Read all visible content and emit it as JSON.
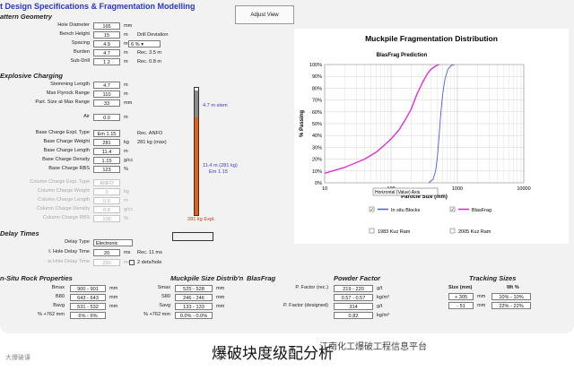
{
  "title": "t Design Specifications & Fragmentation Modelling",
  "adjust_button": "Adjust View",
  "pattern": {
    "heading": "attern Geometry",
    "rows": [
      {
        "label": "Hole Diameter",
        "value": "165",
        "unit": "mm",
        "extra": ""
      },
      {
        "label": "Bench Height",
        "value": "15",
        "unit": "m",
        "extra": "Drill Deviation"
      },
      {
        "label": "Spacing",
        "value": "4.9",
        "unit": "m",
        "extra": ""
      },
      {
        "label": "Burden",
        "value": "4.7",
        "unit": "m",
        "extra": "Rec. 3.5 m"
      },
      {
        "label": "Sub-Drill",
        "value": "1.2",
        "unit": "m",
        "extra": "Rec. 0.8 m"
      }
    ],
    "deviation": "6 %"
  },
  "explosive": {
    "heading": "Explosive Charging",
    "rows": [
      {
        "label": "Stemming Length",
        "value": "4.7",
        "unit": "m",
        "extra": ""
      },
      {
        "label": "Max Flyrock Range",
        "value": "110",
        "unit": "m",
        "extra": ""
      },
      {
        "label": "Part. Size at Max Range",
        "value": "33",
        "unit": "mm",
        "extra": ""
      },
      {
        "label": "Air",
        "value": "0.0",
        "unit": "m",
        "extra": ""
      },
      {
        "label": "Base Charge Expl. Type",
        "value": "Em 1.15",
        "unit": "",
        "extra": "Rec. ANFO"
      },
      {
        "label": "Base Charge Weight",
        "value": "281",
        "unit": "kg",
        "extra": "281 kg (max)"
      },
      {
        "label": "Base Charge Length",
        "value": "11.4",
        "unit": "m",
        "extra": ""
      },
      {
        "label": "Base Charge Density",
        "value": "1.15",
        "unit": "g/cc",
        "extra": ""
      },
      {
        "label": "Base Charge RBS",
        "value": "123",
        "unit": "%",
        "extra": ""
      }
    ],
    "column_rows": [
      {
        "label": "Column Charge Expl. Type",
        "value": "ANFO",
        "unit": ""
      },
      {
        "label": "Column Charge Weight",
        "value": "0",
        "unit": "kg"
      },
      {
        "label": "Column Charge Length",
        "value": "0.0",
        "unit": "m"
      },
      {
        "label": "Column Charge Density",
        "value": "0.8",
        "unit": "g/cc"
      },
      {
        "label": "Column Charge RBS",
        "value": "100",
        "unit": "%"
      }
    ]
  },
  "hole_diagram": {
    "stem_label": "4.7 m stem",
    "charge_label_1": "11.4 m (281 kg)",
    "charge_label_2": "Em 1.15",
    "bottom_label": "281 kg Expl."
  },
  "delay": {
    "heading": "Delay Times",
    "type_label": "Delay Type",
    "type_value": "Electronic",
    "hole_label": "I. Hole Delay Time",
    "hole_value": "20",
    "hole_unit": "ms",
    "hole_rec": "Rec. 11 ms",
    "row_label": "w Hole Delay Time",
    "row_value": "250",
    "row_unit": "ms",
    "dets_label": "2 dets/hole"
  },
  "insitu": {
    "heading": "n-Situ Rock Properties",
    "rows": [
      {
        "label": "Bmax",
        "value": "900 - 901",
        "unit": "mm"
      },
      {
        "label": "B80",
        "value": "643 - 643",
        "unit": "mm"
      },
      {
        "label": "Bavg",
        "value": "531 - 532",
        "unit": "mm"
      },
      {
        "label": "% +762 mm",
        "value": "6% - 6%",
        "unit": ""
      }
    ]
  },
  "muckpile": {
    "heading": "Muckpile Size Distrib'n",
    "heading2": "BlasFrag",
    "rows": [
      {
        "label": "Smax",
        "value": "525 - 528",
        "unit": "mm"
      },
      {
        "label": "S80",
        "value": "246 - 246",
        "unit": "mm"
      },
      {
        "label": "Savg",
        "value": "133 - 133",
        "unit": "mm"
      },
      {
        "label": "% +762 mm",
        "value": "0.0% - 0.0%",
        "unit": ""
      }
    ]
  },
  "powder": {
    "heading": "Powder Factor",
    "rows": [
      {
        "label": "P. Factor (rec.)",
        "value": "219 - 220",
        "unit": "g/t"
      },
      {
        "label": "",
        "value": "0.57 - 0.57",
        "unit": "kg/m³"
      },
      {
        "label": "P. Factor (designed)",
        "value": "314",
        "unit": "g/t"
      },
      {
        "label": "",
        "value": "0.82",
        "unit": "kg/m³"
      }
    ]
  },
  "tracking": {
    "heading": "Tracking Sizes",
    "col1": "Size (mm)",
    "col2": "Wt %",
    "rows": [
      {
        "size": "+ 305",
        "unit": "mm",
        "wt": "10% - 10%"
      },
      {
        "size": "- 51",
        "unit": "mm",
        "wt": "22% - 22%"
      }
    ]
  },
  "chart_data": {
    "type": "line",
    "title": "Muckpile Fragmentation Distribution",
    "subtitle": "BlasFrag Prediction",
    "xlabel": "Particle Size (mm)",
    "ylabel": "% Passing",
    "xscale": "log",
    "xlim": [
      10,
      10000
    ],
    "ylim": [
      0,
      100
    ],
    "xticks": [
      "10",
      "100",
      "1000",
      "10000"
    ],
    "yticks": [
      "0%",
      "10%",
      "20%",
      "30%",
      "40%",
      "50%",
      "60%",
      "70%",
      "80%",
      "90%",
      "100%"
    ],
    "tooltip": "Horizontal (Value) Axis",
    "series": [
      {
        "name": "In situ Blocks",
        "color": "#4a5fd6",
        "x": [
          370,
          430,
          470,
          500,
          530,
          560,
          600,
          650,
          720,
          800,
          900
        ],
        "y": [
          0,
          3,
          10,
          22,
          40,
          58,
          75,
          88,
          96,
          99,
          100
        ]
      },
      {
        "name": "BlasFrag",
        "color": "#e020d8",
        "x": [
          10,
          20,
          40,
          60,
          80,
          100,
          133,
          170,
          200,
          246,
          300,
          350,
          400,
          450,
          500,
          528
        ],
        "y": [
          8,
          13,
          20,
          26,
          32,
          37,
          45,
          55,
          62,
          75,
          85,
          92,
          96,
          98,
          99.5,
          100
        ]
      },
      {
        "name": "1983 Kuz Ram",
        "color": "#000000",
        "x": [],
        "y": []
      },
      {
        "name": "2005 Kuz Ram",
        "color": "#000000",
        "x": [],
        "y": []
      }
    ],
    "legend": [
      {
        "name": "In situ Blocks",
        "checked": true
      },
      {
        "name": "BlasFrag",
        "checked": true
      },
      {
        "name": "1983 Kuz Ram",
        "checked": false
      },
      {
        "name": "2005 Kuz Ram",
        "checked": false
      }
    ]
  },
  "footer": {
    "caption": "爆破块度级配分析",
    "watermark_left": "大爆破课",
    "watermark_right": "江南化工爆破工程信息平台"
  }
}
